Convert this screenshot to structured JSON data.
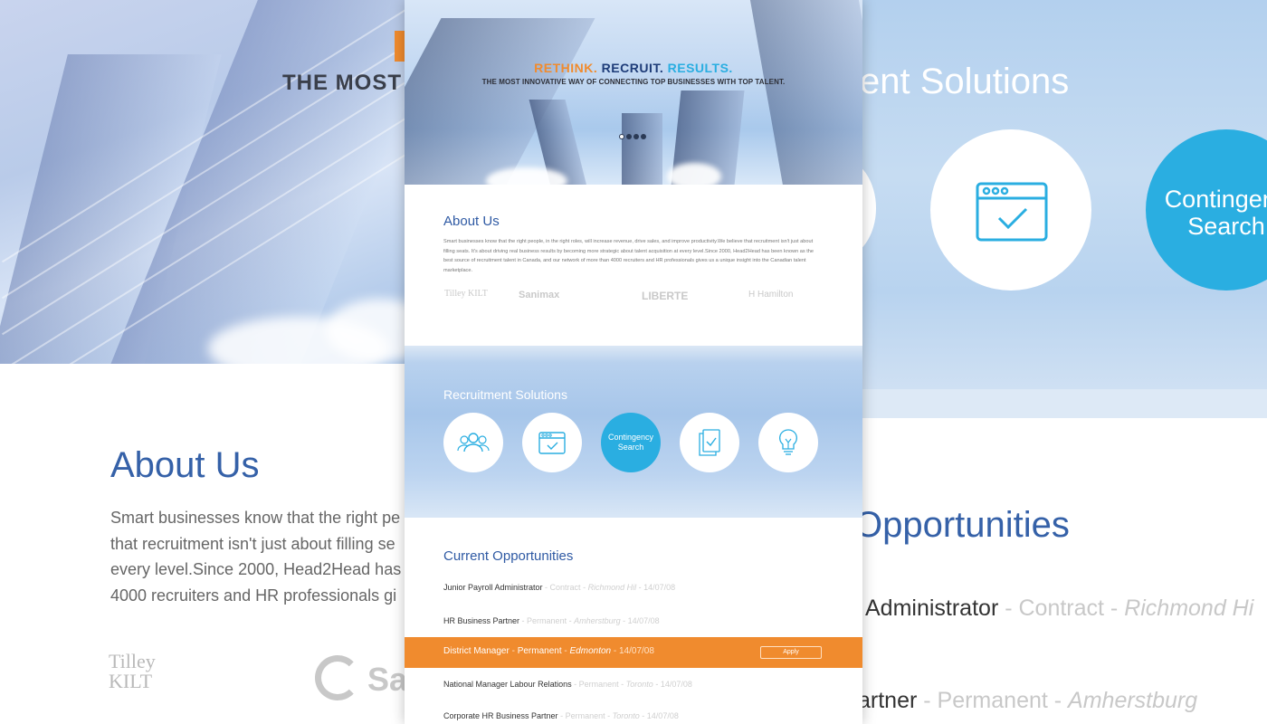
{
  "hero": {
    "slogan_word1": "RETHINK.",
    "slogan_word2": "RECRUIT.",
    "slogan_word3": "RESULTS.",
    "tagline": "THE MOST INNOVATIVE WAY OF CONNECTING TOP BUSINESSES WITH TOP TALENT.",
    "tagline_bg": "THE MOST INNO",
    "slide_count": 4,
    "active_slide": 1
  },
  "about": {
    "title": "About Us",
    "body": "Smart businesses know that the right people, in the right roles, will increase revenue, drive sales, and improve productivity.We believe that recruitment isn't just about filling seats. It's about driving real business results by becoming more strategic about talent acquisition at every level.Since 2000, Head2Head has been known as the best source of recruitment talent in Canada, and our network of more than 4000 recruiters and HR professionals gives us a unique insight into the Canadian talent marketplace.",
    "body_bg_lines": [
      "Smart businesses know that the right pe",
      "that recruitment isn't just about filling se",
      "every level.Since 2000, Head2Head has",
      "4000 recruiters and HR professionals gi"
    ],
    "logos": [
      "Tilley KILT",
      "Sanimax",
      "LIBERTE",
      "H Hamilton"
    ],
    "bg_logo_sanimax": "Sa"
  },
  "recruitment": {
    "title": "Recruitment Solutions",
    "title_bg": "ent Solutions",
    "services": [
      {
        "icon": "people-group-icon"
      },
      {
        "icon": "browser-check-icon"
      },
      {
        "label_line1": "Contingency",
        "label_line2": "Search"
      },
      {
        "icon": "document-check-icon"
      },
      {
        "icon": "lightbulb-icon"
      }
    ],
    "active_bg_line1": "Contingenc",
    "active_bg_line2": "Search"
  },
  "opportunities": {
    "title": "Current Opportunities",
    "title_bg": "Opportunities",
    "jobs": [
      {
        "title": "Junior Payroll Administrator",
        "type": "Contract",
        "location": "Richmond Hil",
        "date": "14/07/08"
      },
      {
        "title": "HR Business Partner",
        "type": "Permanent",
        "location": "Amherstburg",
        "date": "14/07/08"
      },
      {
        "title": "District Manager",
        "type": "Permanent",
        "location": "Edmonton",
        "date": "14/07/08"
      },
      {
        "title": "National Manager Labour Relations",
        "type": "Permanent",
        "location": "Toronto",
        "date": "14/07/08"
      },
      {
        "title": "Corporate HR Business Partner",
        "type": "Permanent",
        "location": "Toronto",
        "date": "14/07/08"
      }
    ],
    "bg_row1_title": "Administrator",
    "bg_row1_type": "Contract",
    "bg_row1_location": "Richmond Hi",
    "bg_row2_title": "artner",
    "bg_row2_type": "Permanent",
    "bg_row2_location": "Amherstburg",
    "apply_label": "Apply",
    "sep": " - "
  },
  "colors": {
    "brand_orange": "#f08b2e",
    "brand_navy": "#1e3c78",
    "brand_blue": "#2aaee1",
    "heading_blue": "#2f5aa4"
  }
}
